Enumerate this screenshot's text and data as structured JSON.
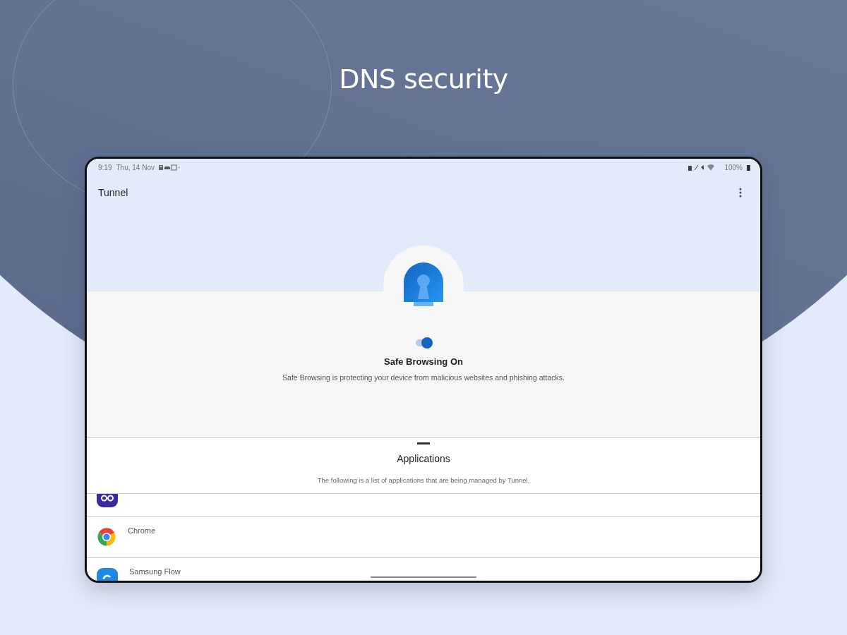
{
  "headline": "DNS security",
  "status_bar": {
    "time": "9:19",
    "date": "Thu, 14 Nov",
    "battery": "100%"
  },
  "app_bar": {
    "title": "Tunnel"
  },
  "protection": {
    "on": true,
    "title": "Safe Browsing On",
    "description": "Safe Browsing is protecting your device from malicious websites and phishing attacks."
  },
  "sheet": {
    "title": "Applications",
    "description": "The following is a list of applications that are being managed by Tunnel.",
    "apps": [
      {
        "kind": "pass"
      },
      {
        "kind": "chrome",
        "name": "Chrome"
      },
      {
        "kind": "flow",
        "name": "Samsung Flow"
      }
    ]
  }
}
